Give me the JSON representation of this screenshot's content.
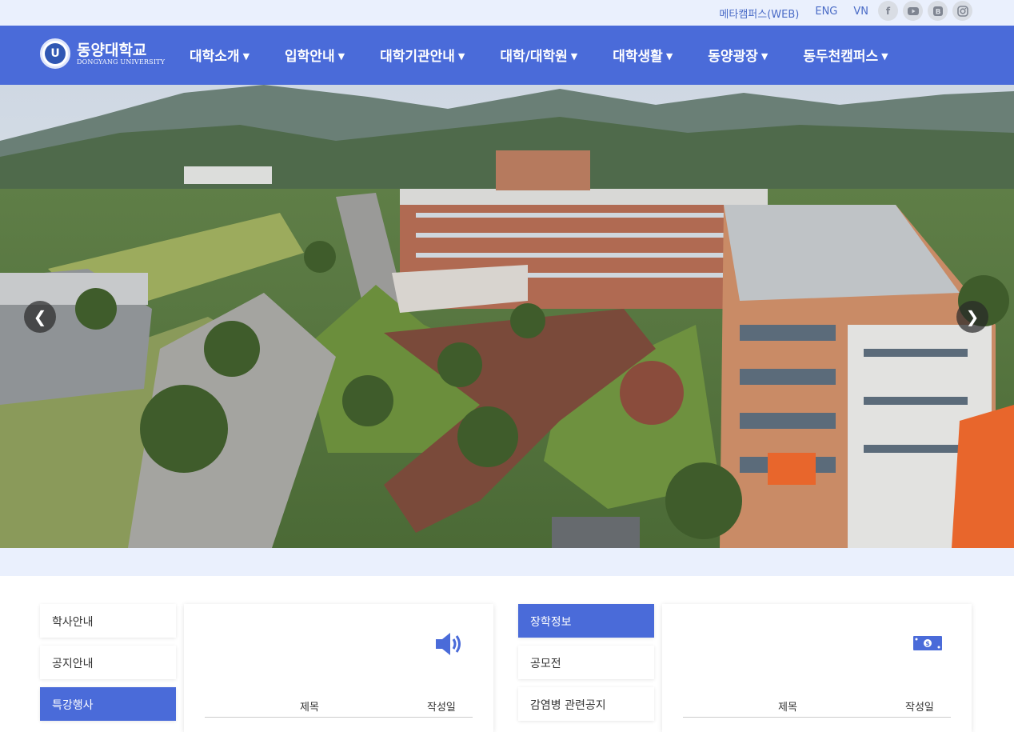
{
  "topbar": {
    "links": [
      "메타캠퍼스(WEB)",
      "ENG",
      "VN"
    ],
    "social": [
      "facebook-icon",
      "youtube-icon",
      "blog-icon",
      "instagram-icon"
    ]
  },
  "logo": {
    "name": "동양대학교",
    "sub": "DONGYANG UNIVERSITY"
  },
  "menu": [
    "대학소개",
    "입학안내",
    "대학기관안내",
    "대학/대학원",
    "대학생활",
    "동양광장",
    "동두천캠퍼스"
  ],
  "colors": {
    "primary": "#4a6bd9",
    "band": "#eaf0fd"
  },
  "left_tabs": [
    "학사안내",
    "공지안내",
    "특강행사"
  ],
  "right_tabs": [
    "장학정보",
    "공모전",
    "감염병 관련공지"
  ],
  "left_panel": {
    "col_title": "제목",
    "col_date": "작성일"
  },
  "right_panel": {
    "col_title": "제목",
    "col_date": "작성일"
  }
}
